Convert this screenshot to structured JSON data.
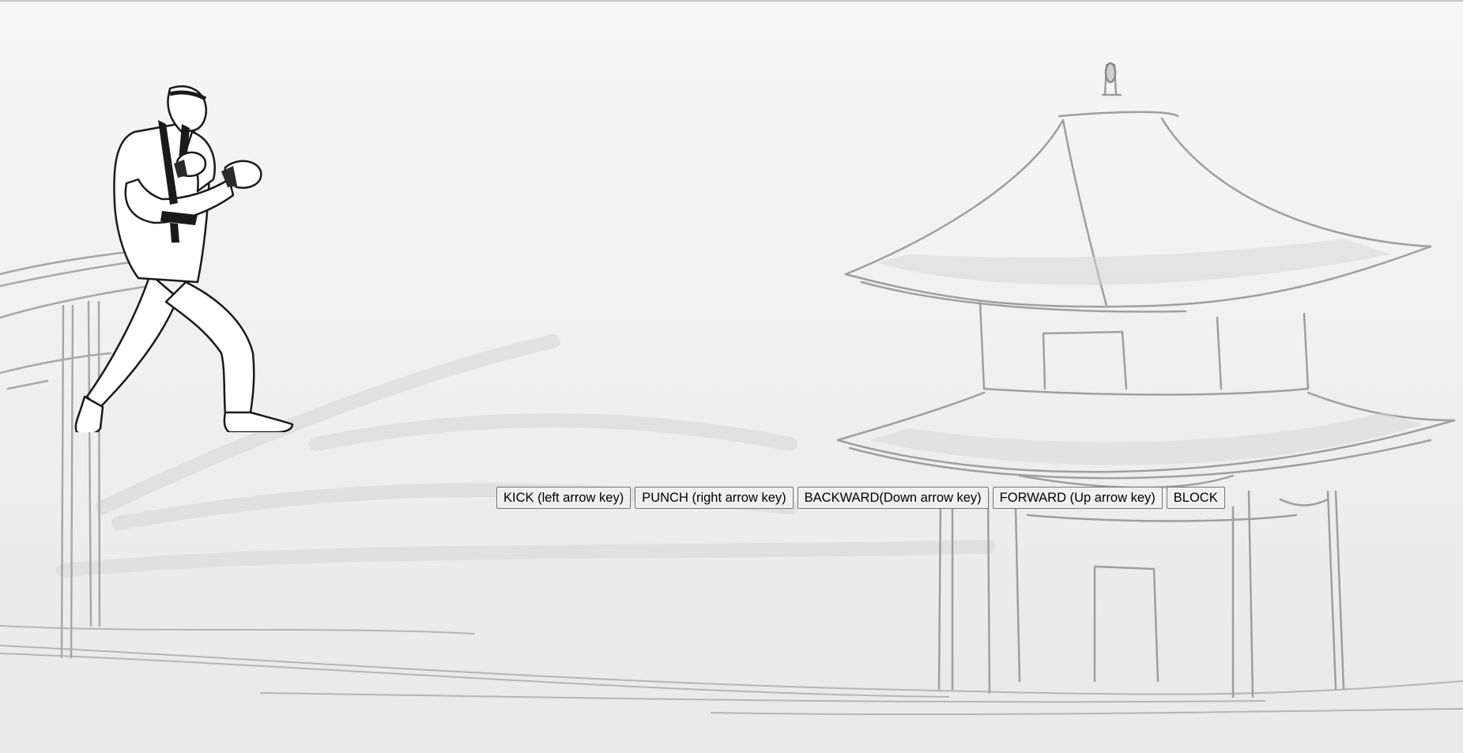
{
  "game": {
    "scene": "pagoda-courtyard",
    "character": "karate-fighter",
    "palette": {
      "background": "#f2f2f2",
      "sketch_light": "#bdbdbd",
      "sketch_dark": "#1a1a1a"
    }
  },
  "controls": {
    "kick_label": "KICK (left arrow key)",
    "punch_label": "PUNCH (right arrow key)",
    "backward_label": "BACKWARD(Down arrow key)",
    "forward_label": "FORWARD (Up arrow key)",
    "block_label": "BLOCK"
  }
}
